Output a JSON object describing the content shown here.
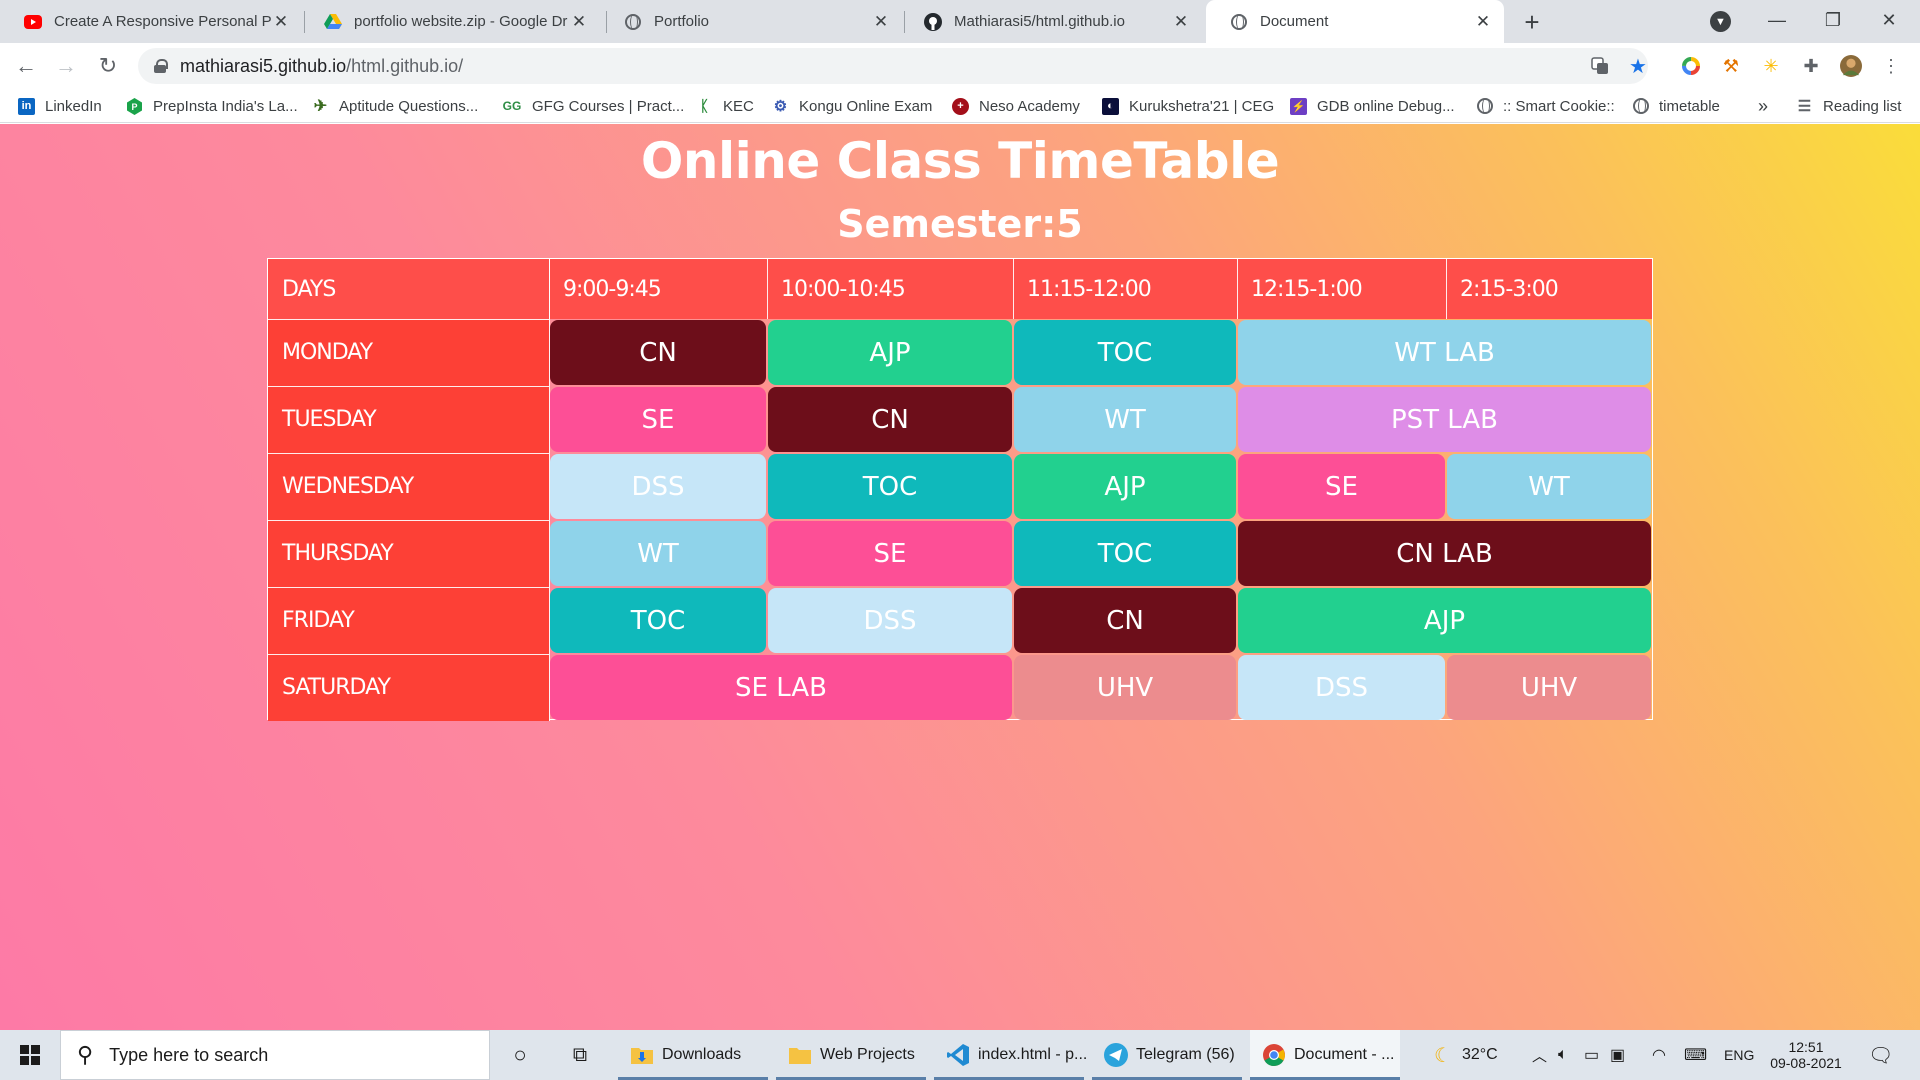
{
  "browser": {
    "tabs": [
      {
        "title": "Create A Responsive Personal PC",
        "icon": "youtube-icon",
        "active": false
      },
      {
        "title": "portfolio website.zip - Google Dr",
        "icon": "google-drive-icon",
        "active": false
      },
      {
        "title": "Portfolio",
        "icon": "globe-icon",
        "active": false
      },
      {
        "title": "Mathiarasi5/html.github.io",
        "icon": "github-icon",
        "active": false
      },
      {
        "title": "Document",
        "icon": "globe-icon",
        "active": true
      }
    ],
    "new_tab": "+",
    "url": {
      "host": "mathiarasi5.github.io",
      "path": "/html.github.io/"
    },
    "bookmarks": [
      {
        "label": "LinkedIn",
        "icon": "linkedin-icon"
      },
      {
        "label": "PrepInsta India's La...",
        "icon": "prepinsta-icon"
      },
      {
        "label": "Aptitude Questions...",
        "icon": "aptitude-icon"
      },
      {
        "label": "GFG Courses | Pract...",
        "icon": "gfg-icon"
      },
      {
        "label": "KEC",
        "icon": "kec-icon"
      },
      {
        "label": "Kongu Online Exam",
        "icon": "kongu-icon"
      },
      {
        "label": "Neso Academy",
        "icon": "neso-icon"
      },
      {
        "label": "Kurukshetra'21 | CEG",
        "icon": "kurukshetra-icon"
      },
      {
        "label": "GDB online Debug...",
        "icon": "gdb-icon"
      },
      {
        "label": ":: Smart Cookie::",
        "icon": "globe-icon"
      },
      {
        "label": "timetable",
        "icon": "globe-icon"
      }
    ],
    "bookmarks_overflow": "»",
    "reading_list": "Reading list"
  },
  "page": {
    "heading": "Online Class TimeTable",
    "subheading": "Semester:5",
    "table": {
      "headers": [
        "DAYS",
        "9:00-9:45",
        "10:00-10:45",
        "11:15-12:00",
        "12:15-1:00",
        "2:15-3:00"
      ],
      "days": [
        "MONDAY",
        "TUESDAY",
        "WEDNESDAY",
        "THURSDAY",
        "FRIDAY",
        "SATURDAY"
      ],
      "rows": [
        [
          {
            "label": "CN",
            "span": 1,
            "color": "#6d0e1a"
          },
          {
            "label": "AJP",
            "span": 1,
            "color": "#22d08f"
          },
          {
            "label": "TOC",
            "span": 1,
            "color": "#0fb9bb"
          },
          {
            "label": "WT LAB",
            "span": 2,
            "color": "#8fd3ea"
          }
        ],
        [
          {
            "label": "SE",
            "span": 1,
            "color": "#fd4f96"
          },
          {
            "label": "CN",
            "span": 1,
            "color": "#6d0e1a"
          },
          {
            "label": "WT",
            "span": 1,
            "color": "#8fd3ea"
          },
          {
            "label": "PST LAB",
            "span": 2,
            "color": "#de8de7"
          }
        ],
        [
          {
            "label": "DSS",
            "span": 1,
            "color": "#c6e6f8"
          },
          {
            "label": "TOC",
            "span": 1,
            "color": "#0fb9bb"
          },
          {
            "label": "AJP",
            "span": 1,
            "color": "#22d08f"
          },
          {
            "label": "SE",
            "span": 1,
            "color": "#fd4f96"
          },
          {
            "label": "WT",
            "span": 1,
            "color": "#8fd3ea"
          }
        ],
        [
          {
            "label": "WT",
            "span": 1,
            "color": "#8fd3ea"
          },
          {
            "label": "SE",
            "span": 1,
            "color": "#fd4f96"
          },
          {
            "label": "TOC",
            "span": 1,
            "color": "#0fb9bb"
          },
          {
            "label": "CN LAB",
            "span": 2,
            "color": "#6d0e1a"
          }
        ],
        [
          {
            "label": "TOC",
            "span": 1,
            "color": "#0fb9bb"
          },
          {
            "label": "DSS",
            "span": 1,
            "color": "#c6e6f8"
          },
          {
            "label": "CN",
            "span": 1,
            "color": "#6d0e1a"
          },
          {
            "label": "AJP",
            "span": 2,
            "color": "#22d08f"
          }
        ],
        [
          {
            "label": "SE LAB",
            "span": 2,
            "color": "#fd4f96"
          },
          {
            "label": "UHV",
            "span": 1,
            "color": "#ec8c8e"
          },
          {
            "label": "DSS",
            "span": 1,
            "color": "#c6e6f8"
          },
          {
            "label": "UHV",
            "span": 1,
            "color": "#ec8c8e"
          }
        ]
      ]
    }
  },
  "taskbar": {
    "search_placeholder": "Type here to search",
    "apps": [
      {
        "label": "Downloads",
        "icon": "folder-icon"
      },
      {
        "label": "Web Projects",
        "icon": "folder-icon"
      },
      {
        "label": "index.html - p...",
        "icon": "vscode-icon"
      },
      {
        "label": "Telegram (56)",
        "icon": "telegram-icon"
      },
      {
        "label": "Document - ...",
        "icon": "chrome-icon"
      }
    ],
    "weather": "32°C",
    "language": "ENG",
    "time": "12:51",
    "date": "09-08-2021"
  }
}
